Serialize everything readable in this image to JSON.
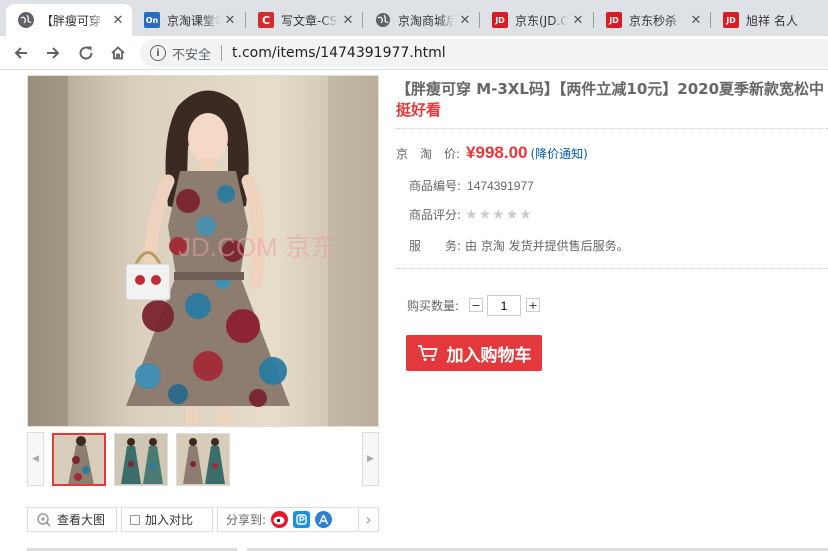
{
  "tabs": [
    {
      "title": "【胖瘦可穿",
      "icon": "globe-icon",
      "active": true
    },
    {
      "title": "京淘课堂笔记",
      "icon": "on-icon",
      "active": false
    },
    {
      "title": "写文章-CSDN",
      "icon": "csdn-icon",
      "active": false
    },
    {
      "title": "京淘商城后台",
      "icon": "globe-icon",
      "active": false
    },
    {
      "title": "京东(JD.COM)",
      "icon": "jd-icon",
      "active": false
    },
    {
      "title": "京东秒杀",
      "icon": "jd-icon",
      "active": false
    },
    {
      "title": "旭祥 名人",
      "icon": "jd-icon",
      "active": false
    }
  ],
  "tab_icon_text": {
    "on": "On",
    "csdn": "C",
    "jd": "JD"
  },
  "address_bar": {
    "security_label": "不安全",
    "url": "t.com/items/1474391977.html"
  },
  "product": {
    "title_line1": "【胖瘦可穿 M-3XL码】【两件立减10元】2020夏季新款宽松中",
    "title_line2": "挺好看",
    "price_label": "京　淘　价:",
    "price": "¥998.00",
    "price_notify": "(降价通知)",
    "sku_label": "商品编号:",
    "sku": "1474391977",
    "rating_label": "商品评分:",
    "rating": 0,
    "service_label": "服　　务:",
    "service": "由 京淘 发货并提供售后服务。",
    "watermark": "JD.COM 京东"
  },
  "purchase": {
    "qty_label": "购买数量:",
    "qty_minus": "−",
    "qty_value": "1",
    "qty_plus": "+",
    "add_to_cart": "加入购物车"
  },
  "gallery": {
    "view_large": "查看大图",
    "compare": "加入对比",
    "share_label": "分享到:",
    "share_more": "›",
    "prev": "◀",
    "next": "▶"
  },
  "colors": {
    "accent": "#e4393c",
    "link": "#005ea7"
  }
}
